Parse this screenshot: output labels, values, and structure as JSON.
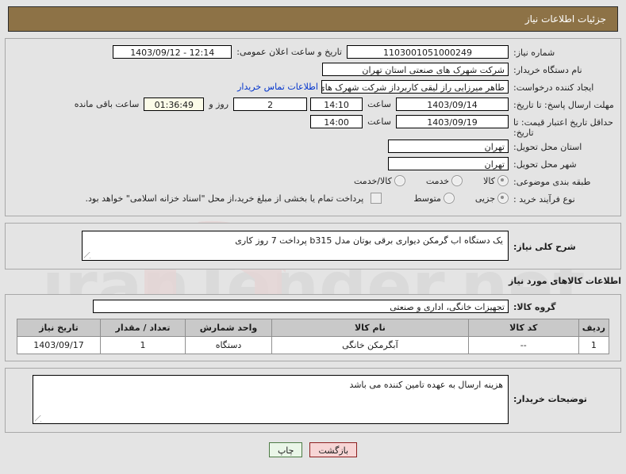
{
  "header": {
    "title": "جزئیات اطلاعات نیاز"
  },
  "form": {
    "need_number": {
      "label": "شماره نیاز:",
      "value": "1103001051000249"
    },
    "announce": {
      "label": "تاریخ و ساعت اعلان عمومی:",
      "value": "12:14 - 1403/09/12"
    },
    "buyer_org": {
      "label": "نام دستگاه خریدار:",
      "value": "شرکت شهرک های صنعتی استان تهران"
    },
    "request_creator": {
      "label": "ایجاد کننده درخواست:",
      "value": "طاهر  میرزایی راز لیقی کاربرداز شرکت شهرک های صنعتی استان تهران"
    },
    "contact_link": "اطلاعات تماس خریدار",
    "response_deadline": {
      "label": "مهلت ارسال پاسخ: تا تاریخ:",
      "date": "1403/09/14",
      "time_label": "ساعت",
      "time": "14:10",
      "days": "2",
      "days_label": "روز و",
      "countdown": "01:36:49",
      "countdown_label": "ساعت باقی مانده"
    },
    "price_validity": {
      "label": "حداقل تاریخ اعتبار قیمت: تا تاریخ:",
      "date": "1403/09/19",
      "time_label": "ساعت",
      "time": "14:00"
    },
    "delivery_province": {
      "label": "استان محل تحویل:",
      "value": "تهران"
    },
    "delivery_city": {
      "label": "شهر محل تحویل:",
      "value": "تهران"
    },
    "subject_class": {
      "label": "طبقه بندی موضوعی:",
      "options": [
        "کالا",
        "خدمت",
        "کالا/خدمت"
      ],
      "selected": "کالا"
    },
    "purchase_process": {
      "label": "نوع فرآیند خرید :",
      "options": [
        "جزیی",
        "متوسط"
      ],
      "selected": "جزیی"
    },
    "treasury_note": "پرداخت تمام یا بخشی از مبلغ خرید،از محل \"اسناد خزانه اسلامی\" خواهد بود.",
    "general_description": {
      "label": "شرح کلی نیاز:",
      "value": "یک دستگاه اب گرمکن دیواری برقی بوتان مدل b315   پرداخت 7 روز کاری"
    },
    "goods_section_title": "اطلاعات کالاهای مورد نیاز",
    "goods_group": {
      "label": "گروه کالا:",
      "value": "تجهیزات خانگی، اداری و صنعتی"
    },
    "buyer_notes": {
      "label": "توضیحات خریدار:",
      "value": "هزینه ارسال به عهده تامین کننده می باشد"
    }
  },
  "goods_table": {
    "columns": [
      "ردیف",
      "کد کالا",
      "نام کالا",
      "واحد شمارش",
      "تعداد / مقدار",
      "تاریخ نیاز"
    ],
    "rows": [
      {
        "radif": "1",
        "code": "--",
        "name": "آبگرمکن خانگی",
        "unit": "دستگاه",
        "qty": "1",
        "date": "1403/09/17"
      }
    ]
  },
  "footer": {
    "back_label": "بازگشت",
    "print_label": "چاپ"
  },
  "colors": {
    "header_bg": "#8d7246",
    "page_bg": "#e4e4e4",
    "link": "#0033cc",
    "back_btn": "#f7d5d5",
    "print_btn": "#eaf6e8",
    "table_header": "#c9c9c9",
    "countdown_bg": "#fbfbe8"
  },
  "watermark": {
    "text": "iranTender.net"
  }
}
